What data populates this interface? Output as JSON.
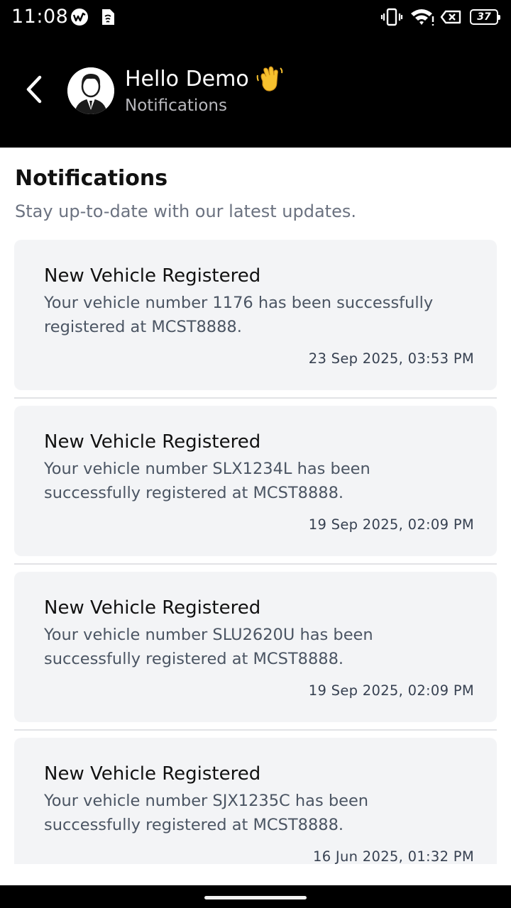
{
  "status_bar": {
    "time": "11:08",
    "battery": "37",
    "icons": [
      "app-notification-icon",
      "sim-card-icon",
      "vibrate-icon",
      "wifi-icon",
      "no-sim-icon",
      "battery-icon"
    ]
  },
  "header": {
    "greeting": "Hello Demo",
    "subtitle": "Notifications",
    "back_icon": "chevron-left-icon",
    "avatar_icon": "user-avatar-icon",
    "emoji_icon": "waving-hand-icon"
  },
  "page": {
    "title": "Notifications",
    "description": "Stay up-to-date with our latest updates."
  },
  "notifications": [
    {
      "title": "New Vehicle Registered",
      "body": "Your vehicle number 1176 has been successfully registered at MCST8888.",
      "time": "23 Sep 2025, 03:53 PM"
    },
    {
      "title": "New Vehicle Registered",
      "body": "Your vehicle number SLX1234L has been successfully registered at MCST8888.",
      "time": "19 Sep 2025, 02:09 PM"
    },
    {
      "title": "New Vehicle Registered",
      "body": "Your vehicle number SLU2620U has been successfully registered at MCST8888.",
      "time": "19 Sep 2025, 02:09 PM"
    },
    {
      "title": "New Vehicle Registered",
      "body": "Your vehicle number SJX1235C has been successfully registered at MCST8888.",
      "time": "16 Jun 2025, 01:32 PM"
    }
  ],
  "colors": {
    "header_bg": "#000000",
    "card_bg": "#f3f4f6",
    "subtitle_gray": "#6b7280"
  }
}
